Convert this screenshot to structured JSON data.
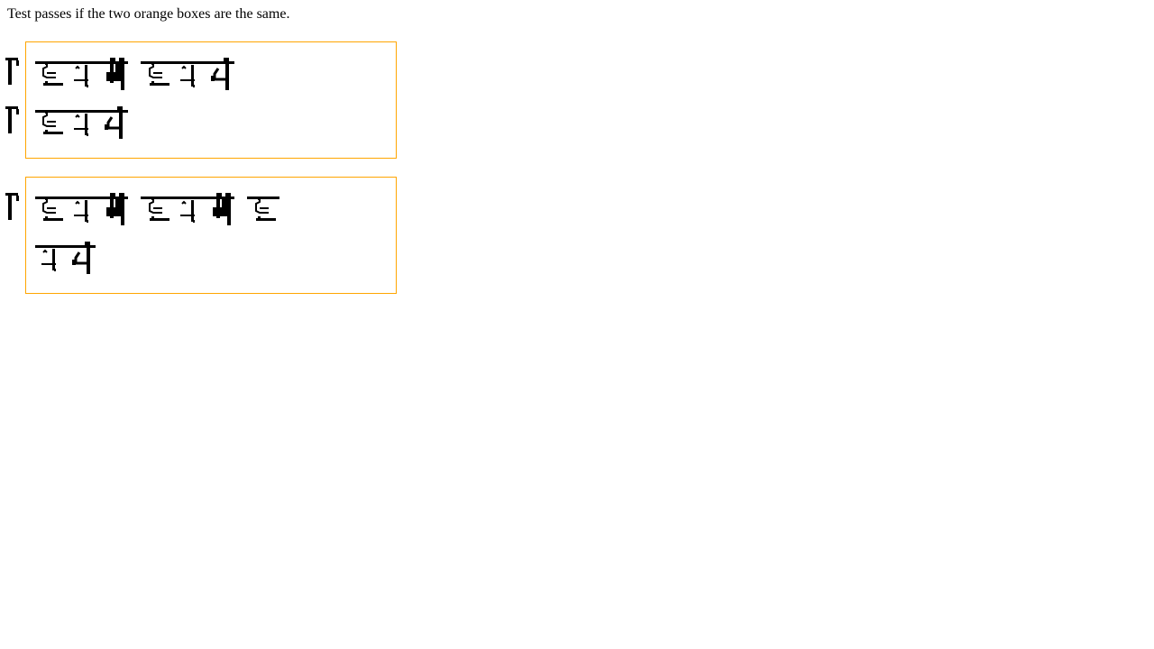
{
  "instruction": "Test passes if the two orange boxes are the same.",
  "colors": {
    "box_border": "#ffa500",
    "text": "#000000",
    "background": "#ffffff"
  },
  "box1": {
    "lines": [
      [
        "glyph-a",
        "glyph-b",
        "glyph-c",
        "space",
        "glyph-a",
        "glyph-b",
        "glyph-d"
      ],
      [
        "glyph-a",
        "glyph-b",
        "glyph-c"
      ]
    ]
  },
  "box2": {
    "lines": [
      [
        "glyph-a",
        "glyph-b",
        "glyph-c",
        "space",
        "glyph-a",
        "glyph-b",
        "glyph-c",
        "space",
        "glyph-a"
      ],
      [
        "glyph-b",
        "glyph-d"
      ]
    ]
  }
}
